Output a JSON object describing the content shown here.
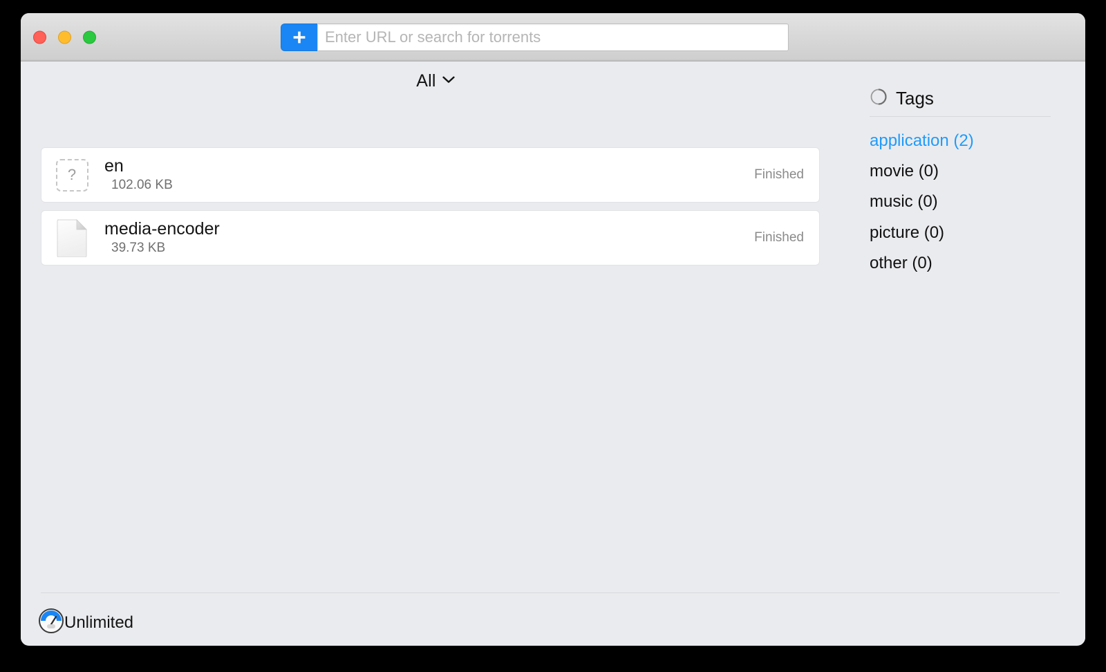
{
  "window": {
    "traffic_lights": [
      {
        "name": "close",
        "color": "#ff6058"
      },
      {
        "name": "minimize",
        "color": "#ffbd2e"
      },
      {
        "name": "zoom",
        "color": "#2bc940"
      }
    ]
  },
  "toolbar": {
    "add_button_icon": "plus-icon",
    "add_button_color": "#1a86f5",
    "url_input": {
      "value": "",
      "placeholder": "Enter URL or search for torrents"
    }
  },
  "filter": {
    "selected": "All",
    "chevron_icon": "chevron-down-icon"
  },
  "torrents": [
    {
      "name": "en",
      "size": "102.06 KB",
      "status": "Finished",
      "icon": "unknown-file-icon",
      "icon_glyph": "?"
    },
    {
      "name": "media-encoder",
      "size": "39.73 KB",
      "status": "Finished",
      "icon": "document-file-icon",
      "icon_glyph": ""
    }
  ],
  "tags": {
    "header": "Tags",
    "header_icon": "circle-icon",
    "active_color": "#1f9bfb",
    "items": [
      {
        "label": "application (2)",
        "active": true
      },
      {
        "label": "movie (0)",
        "active": false
      },
      {
        "label": "music (0)",
        "active": false
      },
      {
        "label": "picture (0)",
        "active": false
      },
      {
        "label": "other (0)",
        "active": false
      }
    ]
  },
  "status_bar": {
    "speed_limit_icon": "speedometer-icon",
    "speed_limit_label": "Unlimited"
  }
}
